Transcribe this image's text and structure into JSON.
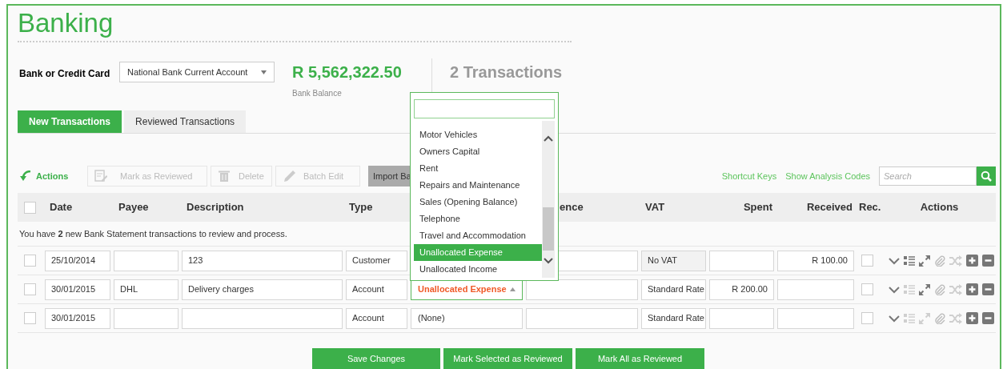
{
  "page_title": "Banking",
  "bank": {
    "label": "Bank or Credit Card",
    "account": "National Bank Current Account",
    "balance": "R 5,562,322.50",
    "balance_label": "Bank Balance",
    "transactions": "2 Transactions"
  },
  "tabs": [
    {
      "label": "New Transactions",
      "selected": true
    },
    {
      "label": "Reviewed Transactions",
      "selected": false
    }
  ],
  "toolbar": {
    "actions_label": "Actions",
    "buttons": [
      {
        "label": "Mark as Reviewed",
        "disabled": true
      },
      {
        "label": "Delete",
        "disabled": true
      },
      {
        "label": "Batch Edit",
        "disabled": true
      }
    ],
    "import_button": "Import Ba",
    "links": [
      "Shortcut Keys",
      "Show Analysis Codes"
    ],
    "search": {
      "placeholder": "Search"
    }
  },
  "table": {
    "select_all_checked": false,
    "columns": [
      "Date",
      "Payee",
      "Description",
      "Type",
      "ence",
      "VAT",
      "Spent",
      "Received",
      "Rec.",
      "Actions"
    ],
    "message": "You have **2** new Bank Statement transactions to review and process.",
    "rows": [
      {
        "checked": false,
        "date": "25/10/2014",
        "description": "123",
        "type": "Customer",
        "vat": "No VAT",
        "vat_disabled": true,
        "received": "R 100.00",
        "reconciled": false,
        "split_enabled": true,
        "expand_enabled": true
      },
      {
        "checked": false,
        "date": "30/01/2015",
        "payee": "DHL",
        "description": "Delivery charges",
        "type": "Account",
        "account": "Unallocated Expense",
        "unallocated": true,
        "open": true,
        "vat": "Standard Rate",
        "vat_disabled": false,
        "spent": "R 200.00",
        "reconciled": false,
        "split_enabled": false,
        "expand_enabled": true
      },
      {
        "checked": false,
        "date": "30/01/2015",
        "type": "Account",
        "account": "(None)",
        "unallocated": false,
        "open": false,
        "vat": "Standard Rate",
        "vat_disabled": false,
        "reconciled": false,
        "split_enabled": false,
        "expand_enabled": false
      }
    ]
  },
  "dropdown": {
    "items": [
      {
        "label": "Motor Vehicles",
        "selected": false
      },
      {
        "label": "Owners Capital",
        "selected": false
      },
      {
        "label": "Rent",
        "selected": false
      },
      {
        "label": "Repairs and Maintenance",
        "selected": false
      },
      {
        "label": "Sales (Opening Balance)",
        "selected": false
      },
      {
        "label": "Telephone",
        "selected": false
      },
      {
        "label": "Travel and Accommodation",
        "selected": false
      },
      {
        "label": "Unallocated Expense",
        "selected": true
      },
      {
        "label": "Unallocated Income",
        "selected": false
      }
    ]
  },
  "footer_buttons": [
    "Save Changes",
    "Mark Selected as Reviewed",
    "Mark All as Reviewed"
  ]
}
